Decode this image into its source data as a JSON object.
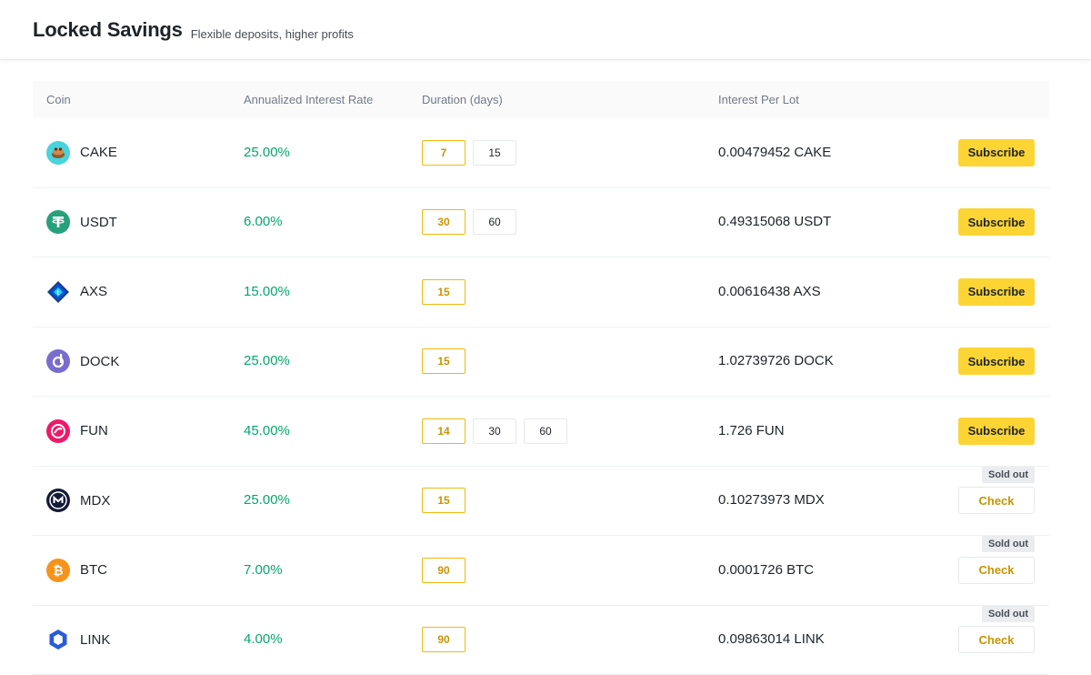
{
  "header": {
    "title": "Locked Savings",
    "subtitle": "Flexible deposits, higher profits"
  },
  "columns": {
    "coin": "Coin",
    "rate": "Annualized Interest Rate",
    "duration": "Duration (days)",
    "interest": "Interest Per Lot"
  },
  "rows": [
    {
      "coin": "CAKE",
      "icon": "cake-icon",
      "rate": "25.00%",
      "durations": [
        "7",
        "15"
      ],
      "selected": 0,
      "interest": "0.00479452 CAKE",
      "action": "Subscribe",
      "sold_out": ""
    },
    {
      "coin": "USDT",
      "icon": "usdt-icon",
      "rate": "6.00%",
      "durations": [
        "30",
        "60"
      ],
      "selected": 0,
      "interest": "0.49315068 USDT",
      "action": "Subscribe",
      "sold_out": ""
    },
    {
      "coin": "AXS",
      "icon": "axs-icon",
      "rate": "15.00%",
      "durations": [
        "15"
      ],
      "selected": 0,
      "interest": "0.00616438 AXS",
      "action": "Subscribe",
      "sold_out": ""
    },
    {
      "coin": "DOCK",
      "icon": "dock-icon",
      "rate": "25.00%",
      "durations": [
        "15"
      ],
      "selected": 0,
      "interest": "1.02739726 DOCK",
      "action": "Subscribe",
      "sold_out": ""
    },
    {
      "coin": "FUN",
      "icon": "fun-icon",
      "rate": "45.00%",
      "durations": [
        "14",
        "30",
        "60"
      ],
      "selected": 0,
      "interest": "1.726 FUN",
      "action": "Subscribe",
      "sold_out": ""
    },
    {
      "coin": "MDX",
      "icon": "mdx-icon",
      "rate": "25.00%",
      "durations": [
        "15"
      ],
      "selected": 0,
      "interest": "0.10273973 MDX",
      "action": "Check",
      "sold_out": "Sold out"
    },
    {
      "coin": "BTC",
      "icon": "btc-icon",
      "rate": "7.00%",
      "durations": [
        "90"
      ],
      "selected": 0,
      "interest": "0.0001726 BTC",
      "action": "Check",
      "sold_out": "Sold out"
    },
    {
      "coin": "LINK",
      "icon": "link-icon",
      "rate": "4.00%",
      "durations": [
        "90"
      ],
      "selected": 0,
      "interest": "0.09863014 LINK",
      "action": "Check",
      "sold_out": "Sold out"
    }
  ],
  "colors": {
    "accent": "#fcd535",
    "rate_green": "#03a66d",
    "selected_border": "#f0b90b"
  }
}
